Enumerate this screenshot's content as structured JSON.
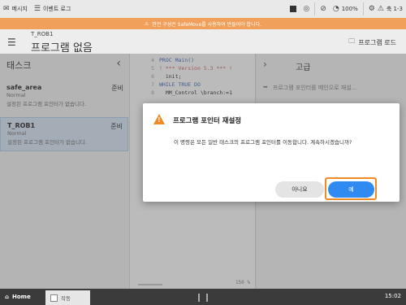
{
  "statusbar": {
    "messages_label": "메시지",
    "eventlog_label": "이벤트 로그",
    "speed_label": "100%",
    "mechunit_label": "축 1-3"
  },
  "warning": {
    "text": "안전 구성은 SafeMove를 사용하여 만들어야 합니다."
  },
  "header": {
    "program_sub": "T_ROB1",
    "program_title": "프로그램 없음",
    "load_label": "프로그램 로드"
  },
  "tasks_panel": {
    "title": "태스크",
    "tasks": [
      {
        "name": "safe_area",
        "state": "준비",
        "mode": "Normal",
        "message": "설정된 프로그램 포인터가 없습니다."
      },
      {
        "name": "T_ROB1",
        "state": "준비",
        "mode": "Normal",
        "message": "설정된 프로그램 포인터가 없습니다."
      }
    ]
  },
  "code": {
    "lines": [
      {
        "num": "4",
        "text": "PROC Main()"
      },
      {
        "num": "5",
        "text": "! *** Version 5.3 *** !"
      },
      {
        "num": "6",
        "text": "  init;"
      },
      {
        "num": "7",
        "text": "WHILE TRUE DO"
      },
      {
        "num": "8",
        "text": "  MM_Control \\branch:=1"
      }
    ],
    "zoom": "150 %"
  },
  "advanced_panel": {
    "title": "고급",
    "item_label": "프로그램 포인터를 메인으로 재설..."
  },
  "dialog": {
    "title": "프로그램 포인터 재설정",
    "message": "이 명령은 모든 일반 태스크의 프로그램 포인터를 이동합니다. 계속하시겠습니까?",
    "no_label": "아니요",
    "yes_label": "예"
  },
  "bottombar": {
    "home_label": "Home",
    "task_tab_label": "작동",
    "clock": "15:02"
  },
  "colors": {
    "warning_bar": "#f0a05a",
    "accent_orange": "#f08a24",
    "primary_blue": "#2f8af1",
    "selected_task_bg": "#dce9f7"
  }
}
